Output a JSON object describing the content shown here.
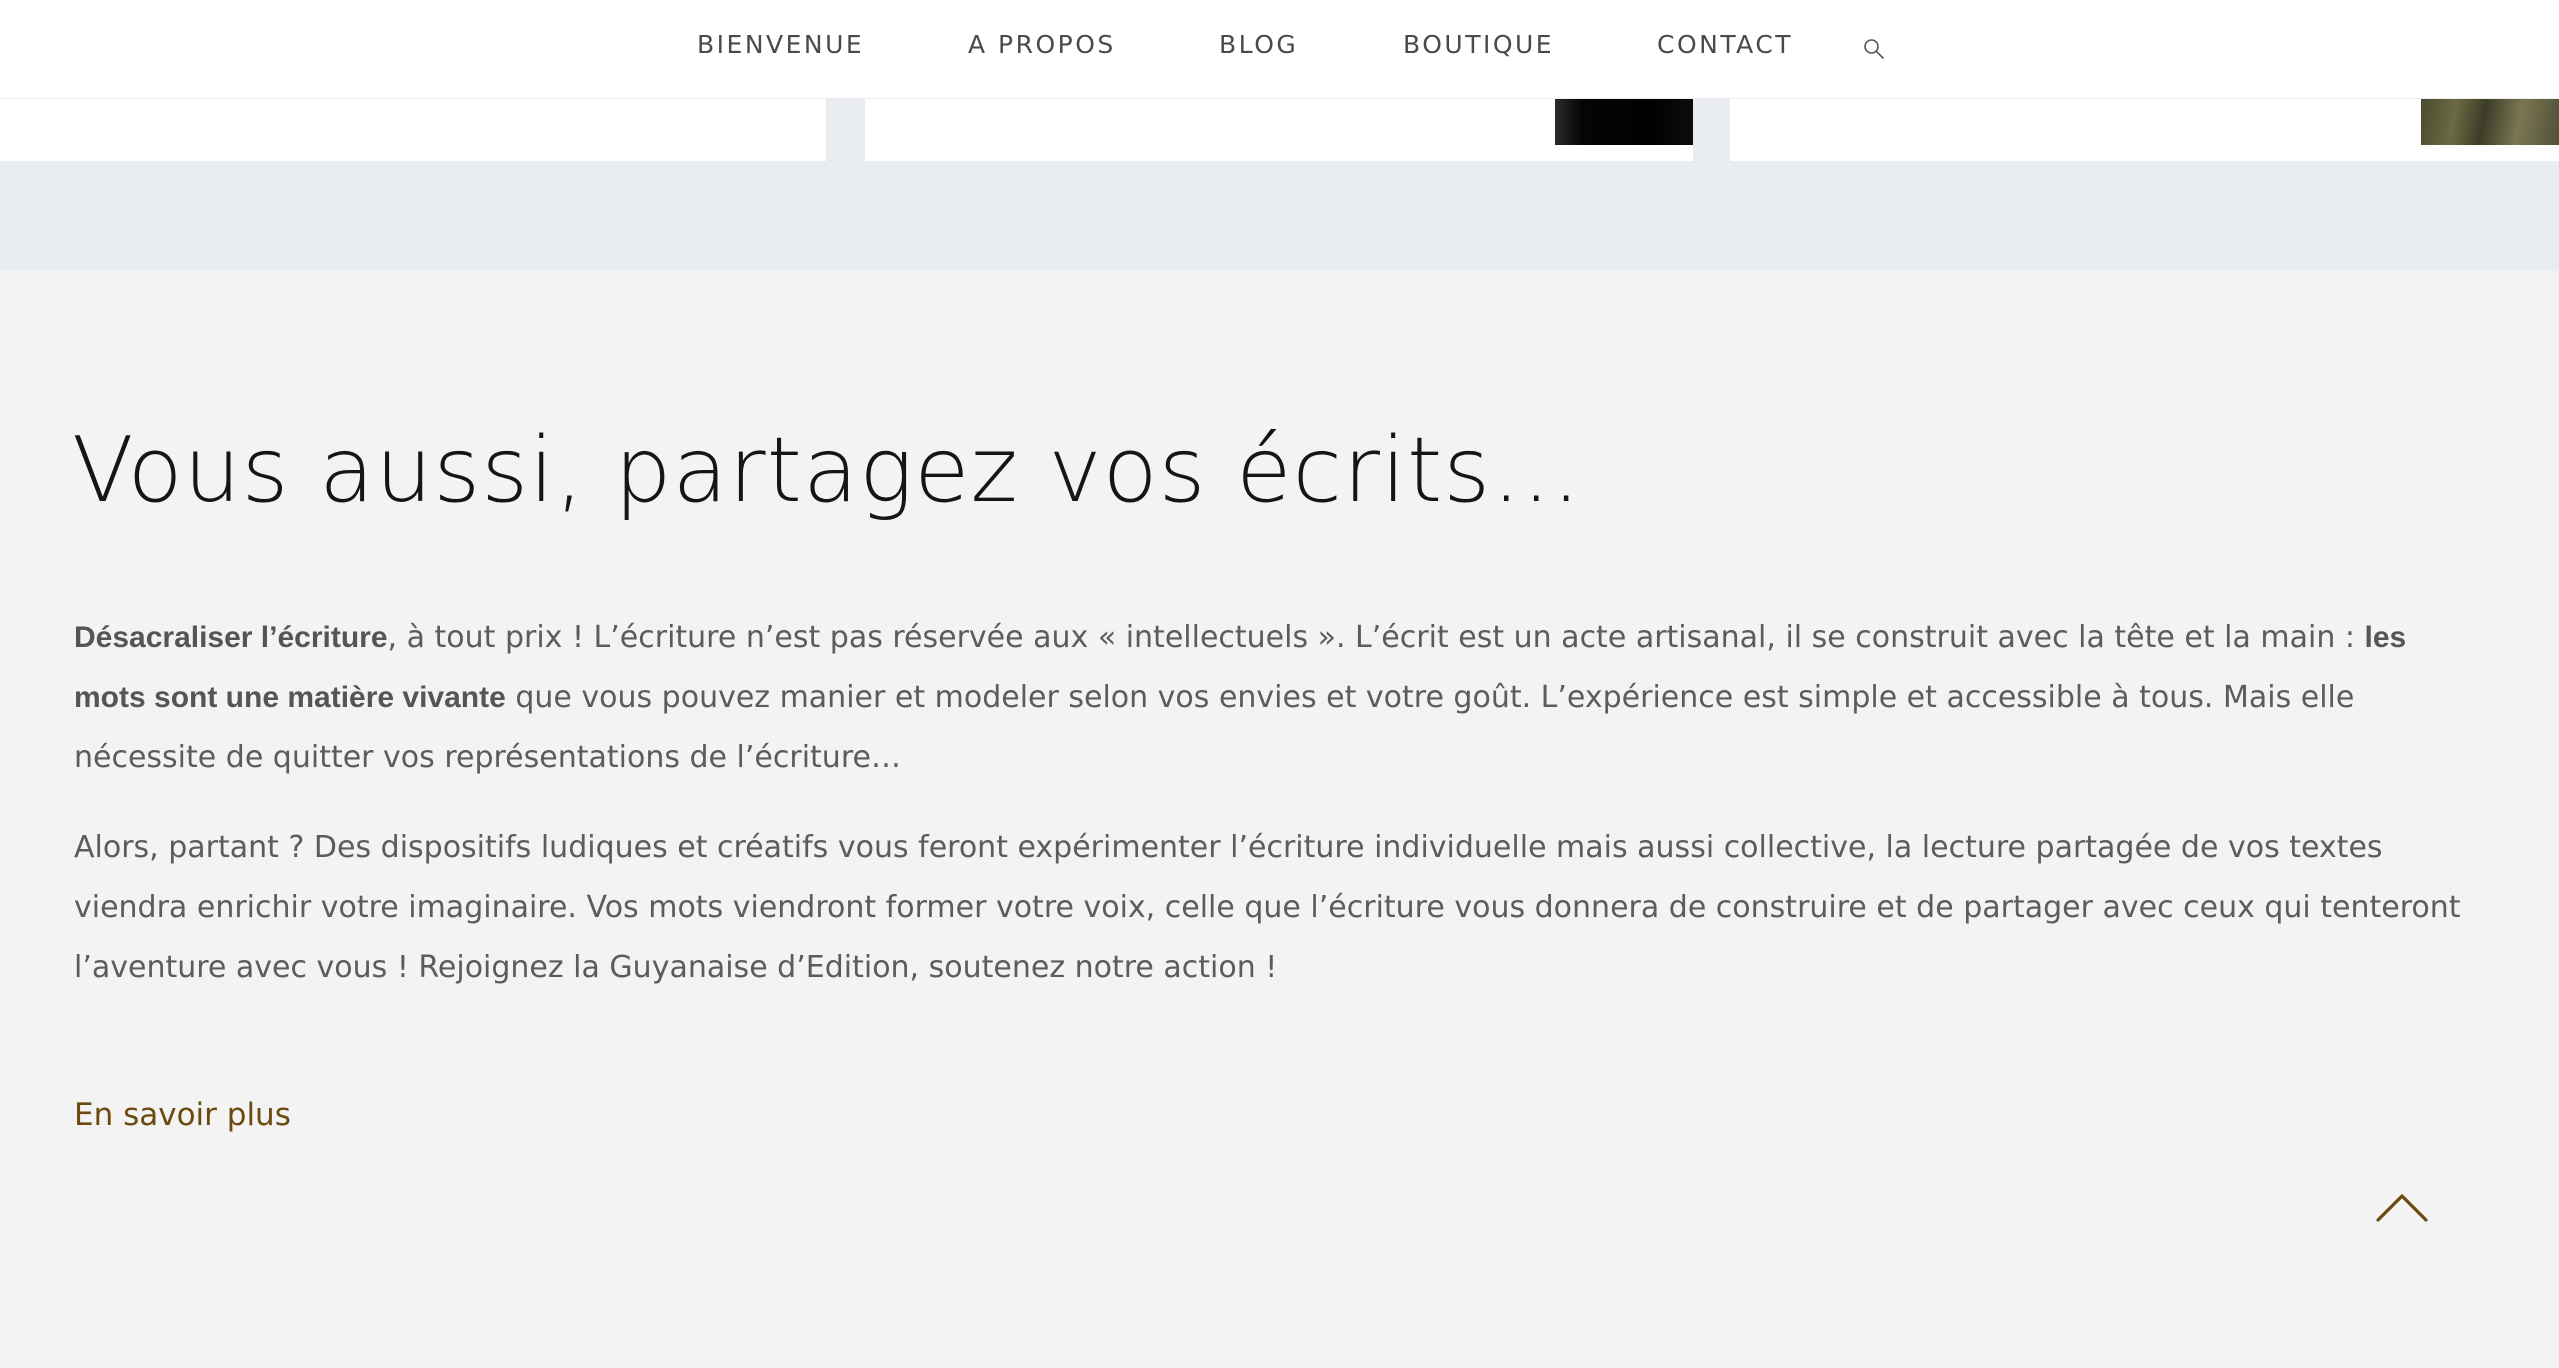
{
  "nav": {
    "items": [
      "BIENVENUE",
      "A PROPOS",
      "BLOG",
      "BOUTIQUE",
      "CONTACT"
    ],
    "search_icon": "search-icon"
  },
  "section": {
    "title": "Vous aussi, partagez vos écrits…",
    "paragraph1": {
      "bold1": "Désacraliser l’écriture",
      "text1": ", à tout prix ! L’écriture n’est pas réservée aux « intellectuels ». L’écrit est un acte artisanal, il se construit avec la tête et la main : ",
      "bold2": "les mots sont une matière vivante",
      "text2": " que vous pouvez manier et modeler selon vos envies et votre goût. L’expérience est simple et accessible à tous. Mais elle nécessite de quitter vos représentations de l’écriture…"
    },
    "paragraph2": "Alors, partant ? Des dispositifs ludiques et créatifs vous feront expérimenter l’écriture individuelle mais aussi collective, la lecture partagée de vos textes viendra enrichir votre imaginaire. Vos mots viendront former votre voix, celle que l’écriture vous donnera de construire et de partager avec ceux qui tenteront l’aventure avec vous ! Rejoignez la Guyanaise d’Edition, soutenez notre action !",
    "link": "En savoir plus"
  },
  "colors": {
    "accent": "#6b4a0f",
    "background": "#f3f3f3",
    "band": "#e9ecf0"
  },
  "icons": {
    "back_to_top": "chevron-up-icon"
  }
}
